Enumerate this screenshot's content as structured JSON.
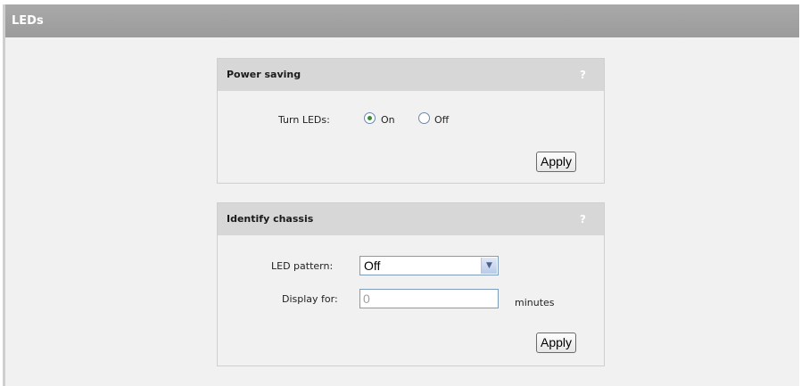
{
  "header": {
    "title": "LEDs"
  },
  "power_saving": {
    "title": "Power saving",
    "help": "?",
    "turn_leds_label": "Turn LEDs:",
    "options": [
      {
        "label": "On",
        "selected": true
      },
      {
        "label": "Off",
        "selected": false
      }
    ],
    "apply_label": "Apply"
  },
  "identify_chassis": {
    "title": "Identify chassis",
    "help": "?",
    "led_pattern_label": "LED pattern:",
    "led_pattern_value": "Off",
    "display_for_label": "Display for:",
    "display_for_value": "0",
    "minutes_label": "minutes",
    "apply_label": "Apply"
  },
  "colors": {
    "header_bg": "#a0a0a0",
    "panel_head_bg": "#d7d7d7",
    "page_bg": "#f1f1f1"
  }
}
